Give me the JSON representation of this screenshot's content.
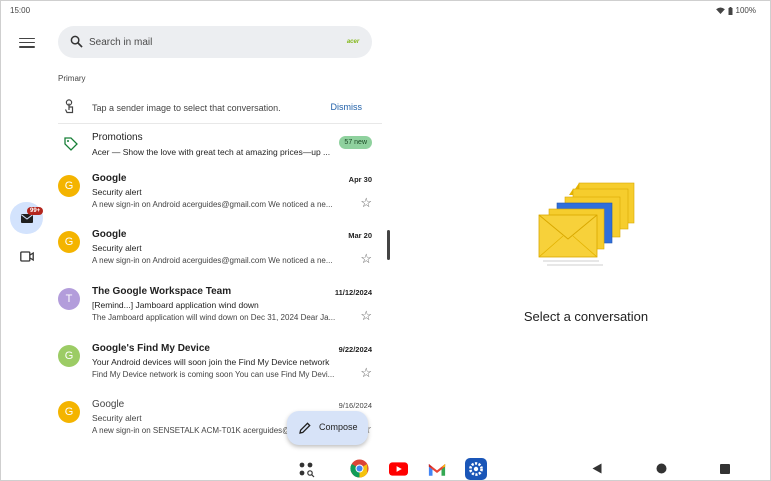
{
  "status_bar": {
    "time": "15:00",
    "battery": "100%"
  },
  "search": {
    "placeholder": "Search in mail",
    "account_logo_text": "acer"
  },
  "section_label": "Primary",
  "tip": {
    "text": "Tap a sender image to select that conversation.",
    "dismiss_label": "Dismiss"
  },
  "promotions": {
    "title": "Promotions",
    "snippet": "Acer — Show the love with great tech at amazing prices—up ...",
    "badge": "57 new",
    "badge_color": "#8fd19e"
  },
  "nav": {
    "mail_badge": "99+"
  },
  "emails": [
    {
      "avatar_letter": "G",
      "avatar_color": "#f4b400",
      "sender": "Google",
      "date": "Apr 30",
      "subject": "Security alert",
      "snippet": "A new sign-in on Android acerguides@gmail.com We noticed a ne...",
      "unread": true
    },
    {
      "avatar_letter": "G",
      "avatar_color": "#f4b400",
      "sender": "Google",
      "date": "Mar 20",
      "subject": "Security alert",
      "snippet": "A new sign-in on Android acerguides@gmail.com We noticed a ne...",
      "unread": true
    },
    {
      "avatar_letter": "T",
      "avatar_color": "#b39ddb",
      "sender": "The Google Workspace Team",
      "date": "11/12/2024",
      "subject": "[Remind...] Jamboard application wind down",
      "snippet": "The Jamboard application will wind down on Dec 31, 2024 Dear Ja...",
      "unread": true
    },
    {
      "avatar_letter": "G",
      "avatar_color": "#9ccc65",
      "sender": "Google's Find My Device",
      "date": "9/22/2024",
      "subject": "Your Android devices will soon join the Find My Device network",
      "snippet": "Find My Device network is coming soon You can use Find My Devi...",
      "unread": true
    },
    {
      "avatar_letter": "G",
      "avatar_color": "#f4b400",
      "sender": "Google",
      "date": "9/16/2024",
      "subject": "Security alert",
      "snippet": "A new sign-in on SENSETALK ACM-T01K acerguides@gmail.com",
      "unread": false
    }
  ],
  "compose_label": "Compose",
  "detail_empty_text": "Select a conversation",
  "colors": {
    "accent": "#0b57d0",
    "selected_nav": "#d3e3fd",
    "compose_bg": "#d7e3f8",
    "badge_red": "#b3261e"
  }
}
